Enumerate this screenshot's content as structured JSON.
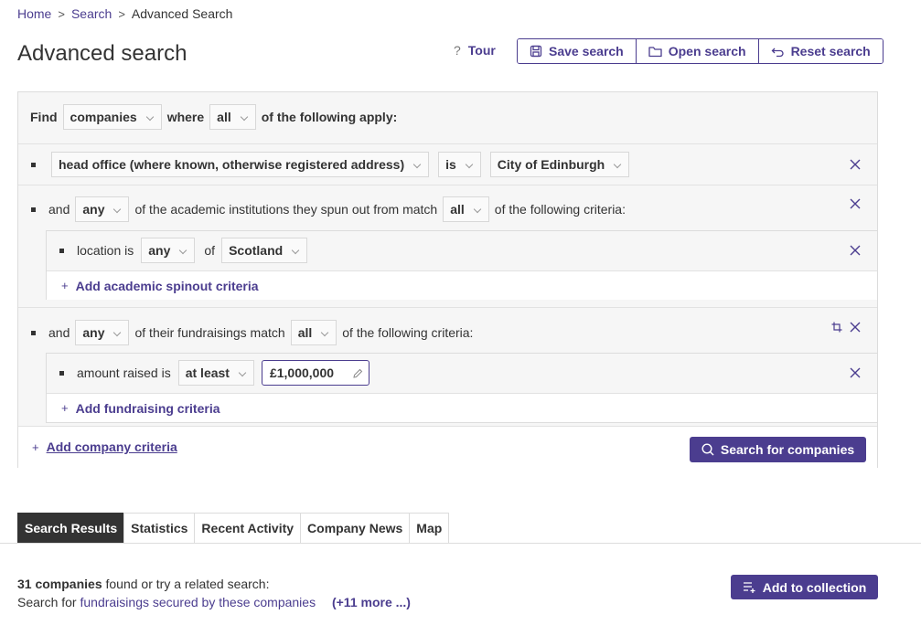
{
  "breadcrumb": {
    "home": "Home",
    "search": "Search",
    "current": "Advanced Search",
    "separator": ">"
  },
  "page": {
    "title": "Advanced search"
  },
  "toolbar": {
    "tour": "Tour",
    "tour_icon": "?",
    "save": "Save search",
    "open": "Open search",
    "reset": "Reset search"
  },
  "query": {
    "find_label": "Find",
    "entity": "companies",
    "where_label": "where",
    "match": "all",
    "apply_label": "of the following apply:",
    "criterion1": {
      "field": "head office (where known, otherwise registered address)",
      "operator": "is",
      "value": "City of Edinburgh"
    },
    "criterion2": {
      "and_label": "and",
      "quantifier": "any",
      "text": "of the academic institutions they spun out from match",
      "match": "all",
      "tail": "of the following criteria:",
      "sub": {
        "label": "location is",
        "quantifier": "any",
        "of_label": "of",
        "value": "Scotland"
      },
      "add_label": "Add academic spinout criteria"
    },
    "criterion3": {
      "and_label": "and",
      "quantifier": "any",
      "text": "of their fundraisings match",
      "match": "all",
      "tail": "of the following criteria:",
      "sub": {
        "label": "amount raised is",
        "operator": "at least",
        "value": "£1,000,000"
      },
      "add_label": "Add fundraising criteria"
    },
    "plus": "+",
    "add_company_label": "Add company criteria",
    "search_button": "Search for companies"
  },
  "tabs": [
    {
      "label": "Search Results",
      "active": true
    },
    {
      "label": "Statistics"
    },
    {
      "label": "Recent Activity"
    },
    {
      "label": "Company News"
    },
    {
      "label": "Map"
    }
  ],
  "results": {
    "count": "31 companies",
    "found_text": "found or try a related search:",
    "search_for": "Search for",
    "related_link": "fundraisings secured by these companies",
    "more": "(+11 more ...)",
    "add_to_collection": "Add to collection"
  },
  "colors": {
    "accent": "#4b3d8f",
    "active_tab": "#333333",
    "panel_bg": "#f6f6f6"
  }
}
